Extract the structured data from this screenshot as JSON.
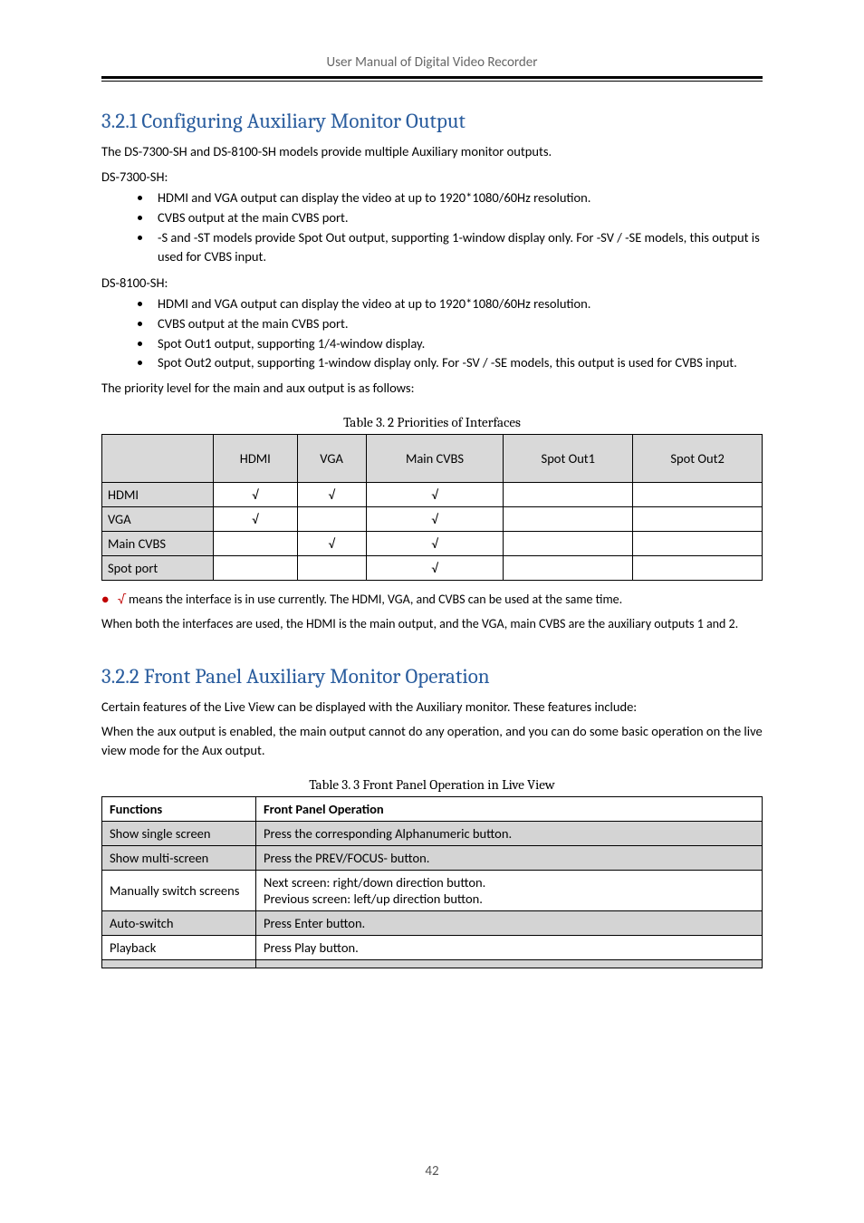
{
  "header": {
    "title": "User Manual of Digital Video Recorder"
  },
  "sections": {
    "config_output": {
      "title": "3.2.1 Configuring Auxiliary Monitor Output",
      "intro": "The DS-7300-SH and DS-8100-SH models provide multiple Auxiliary monitor outputs.",
      "ds7300_label": "DS-7300-SH:",
      "ds7300_items": [
        "HDMI and VGA output can display the video at up to 1920*1080/60Hz resolution.",
        "CVBS output at the main CVBS port.",
        "-S and -ST models provide Spot Out output, supporting 1-window display only. For -SV / -SE models, this output is used for CVBS input."
      ],
      "ds8100_label": "DS-8100-SH:",
      "ds8100_items": [
        "HDMI and VGA output can display the video at up to 1920*1080/60Hz resolution.",
        "CVBS output at the main CVBS port.",
        "Spot Out1 output, supporting 1/4-window display.",
        "Spot Out2 output, supporting 1-window display only. For -SV / -SE models, this output is used for CVBS input."
      ],
      "priority_intro": "The priority level for the main and aux output is as follows:"
    },
    "front_panel_auxiliary": {
      "title": "3.2.2 Front Panel Auxiliary Monitor Operation",
      "timing_note": "Certain features of the Live View can be displayed with the Auxiliary monitor. These features include:",
      "intro_body": "When the aux output is enabled, the main output cannot do any operation, and you can do some basic operation on the live view mode for the Aux output."
    }
  },
  "tables": {
    "priorities": {
      "caption": "Table 3. 2  Priorities of Interfaces",
      "headers": [
        "",
        "HDMI",
        "VGA",
        "Main CVBS",
        "Spot Out1",
        "Spot Out2"
      ],
      "rows": [
        [
          "HDMI",
          "√",
          "√",
          "√",
          "",
          ""
        ],
        [
          "VGA",
          "√",
          "",
          "√",
          "",
          ""
        ],
        [
          "Main CVBS",
          "",
          "√",
          "√",
          "",
          ""
        ],
        [
          "Spot port",
          "",
          "",
          "√",
          "",
          ""
        ]
      ],
      "note_prefix_bullet": "●",
      "note_check": "√",
      "note_text_1": " means the interface is in use currently. ",
      "note_text_2": "The HDMI, VGA, and CVBS can be used at the same time.",
      "note_para": "When both the interfaces are used, the HDMI is the main output, and the VGA, main CVBS are the auxiliary outputs 1 and 2."
    },
    "front_panel": {
      "caption": "Table 3. 3  Front Panel Operation in Live View",
      "headers": [
        "Functions",
        "Front Panel Operation"
      ],
      "rows": [
        [
          "Show single screen",
          "Press the corresponding Alphanumeric button."
        ],
        [
          "Show multi-screen",
          "Press the PREV/FOCUS- button."
        ],
        [
          "Manually switch screens",
          "Next screen: right/down direction button.\nPrevious screen: left/up direction button."
        ],
        [
          "Auto-switch",
          "Press Enter button."
        ],
        [
          "Playback",
          "Press Play button."
        ]
      ]
    }
  },
  "footer": {
    "page": "42"
  }
}
